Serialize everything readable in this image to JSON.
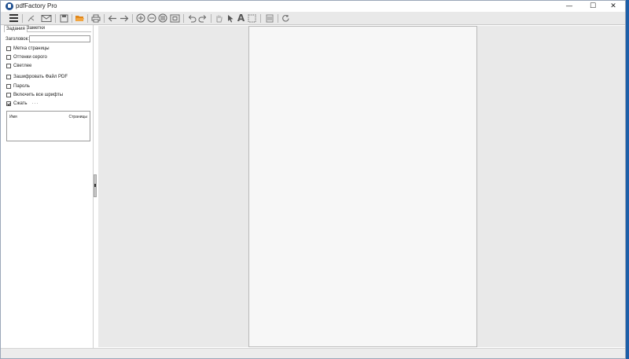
{
  "window": {
    "title": "pdfFactory Pro",
    "min_glyph": "—",
    "max_glyph": "☐",
    "close_glyph": "✕"
  },
  "toolbar": {
    "icons": [
      "menu-icon",
      "share-icon",
      "email-icon",
      "save-icon",
      "open-folder-icon",
      "print-icon",
      "back-arrow-icon",
      "forward-arrow-icon",
      "zoom-in-icon",
      "zoom-out-icon",
      "fit-page-icon",
      "undo-icon",
      "redo-icon",
      "hand-icon",
      "pointer-icon",
      "text-icon",
      "select-area-icon",
      "page-icon",
      "refresh-icon"
    ]
  },
  "sidebar": {
    "tabs": [
      {
        "label": "Задания",
        "active": true
      },
      {
        "label": "Заметки",
        "active": false
      }
    ],
    "title_label": "Заголовок:",
    "title_value": "",
    "options": [
      {
        "label": "Метка страницы",
        "checked": false
      },
      {
        "label": "Оттенки серого",
        "checked": false
      },
      {
        "label": "Светлее",
        "checked": false
      },
      {
        "label": "Зашифровать Файл PDF",
        "checked": false
      },
      {
        "label": "Пароль",
        "checked": false
      },
      {
        "label": "Включить все шрифты",
        "checked": false
      },
      {
        "label": "Сжать",
        "checked": true
      }
    ],
    "compress_more": "···",
    "file_list": {
      "columns": [
        "Имя",
        "Страницы"
      ],
      "rows": []
    }
  },
  "colors": {
    "accent_folder": "#e0861a",
    "workspace_bg": "#e9e9e9",
    "page_bg": "#f7f7f7",
    "app_icon": "#1f4f8f"
  }
}
